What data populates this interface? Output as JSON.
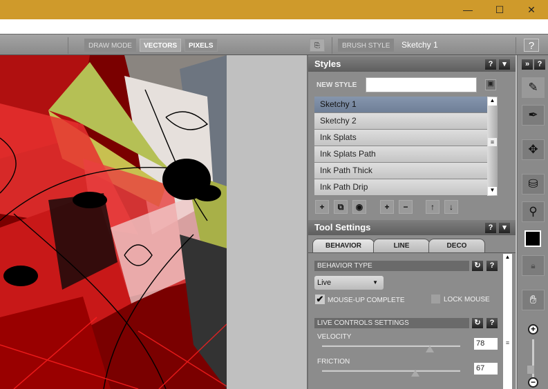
{
  "window": {
    "minimize": "—",
    "maximize": "☐",
    "close": "✕"
  },
  "toolbar": {
    "draw_mode_label": "DRAW MODE",
    "vectors": "VECTORS",
    "pixels": "PIXELS",
    "brush_style_label": "BRUSH STYLE",
    "brush_style_value": "Sketchy 1",
    "help": "?"
  },
  "styles": {
    "title": "Styles",
    "help": "?",
    "new_style_label": "NEW STYLE",
    "new_style_value": "",
    "items": [
      "Sketchy 1",
      "Sketchy 2",
      "Ink Splats",
      "Ink Splats Path",
      "Ink Path Thick",
      "Ink Path Drip"
    ],
    "selected": "Sketchy 1"
  },
  "tool_settings": {
    "title": "Tool Settings",
    "help": "?",
    "tabs": [
      "BEHAVIOR",
      "LINE",
      "DECO"
    ],
    "active_tab": "BEHAVIOR",
    "behavior_type_label": "BEHAVIOR TYPE",
    "behavior_type_value": "Live",
    "mouse_up_label": "MOUSE-UP COMPLETE",
    "mouse_up_checked": true,
    "lock_mouse_label": "LOCK MOUSE",
    "lock_mouse_checked": false,
    "live_controls_label": "LIVE CONTROLS SETTINGS",
    "velocity_label": "VELOCITY",
    "velocity": "78",
    "friction_label": "FRICTION",
    "friction": "67"
  },
  "right_column": {
    "help": "?",
    "color": "#000000"
  },
  "colors": {
    "titlebar": "#cf9a2b",
    "selected_item": "#7a8aa2"
  }
}
